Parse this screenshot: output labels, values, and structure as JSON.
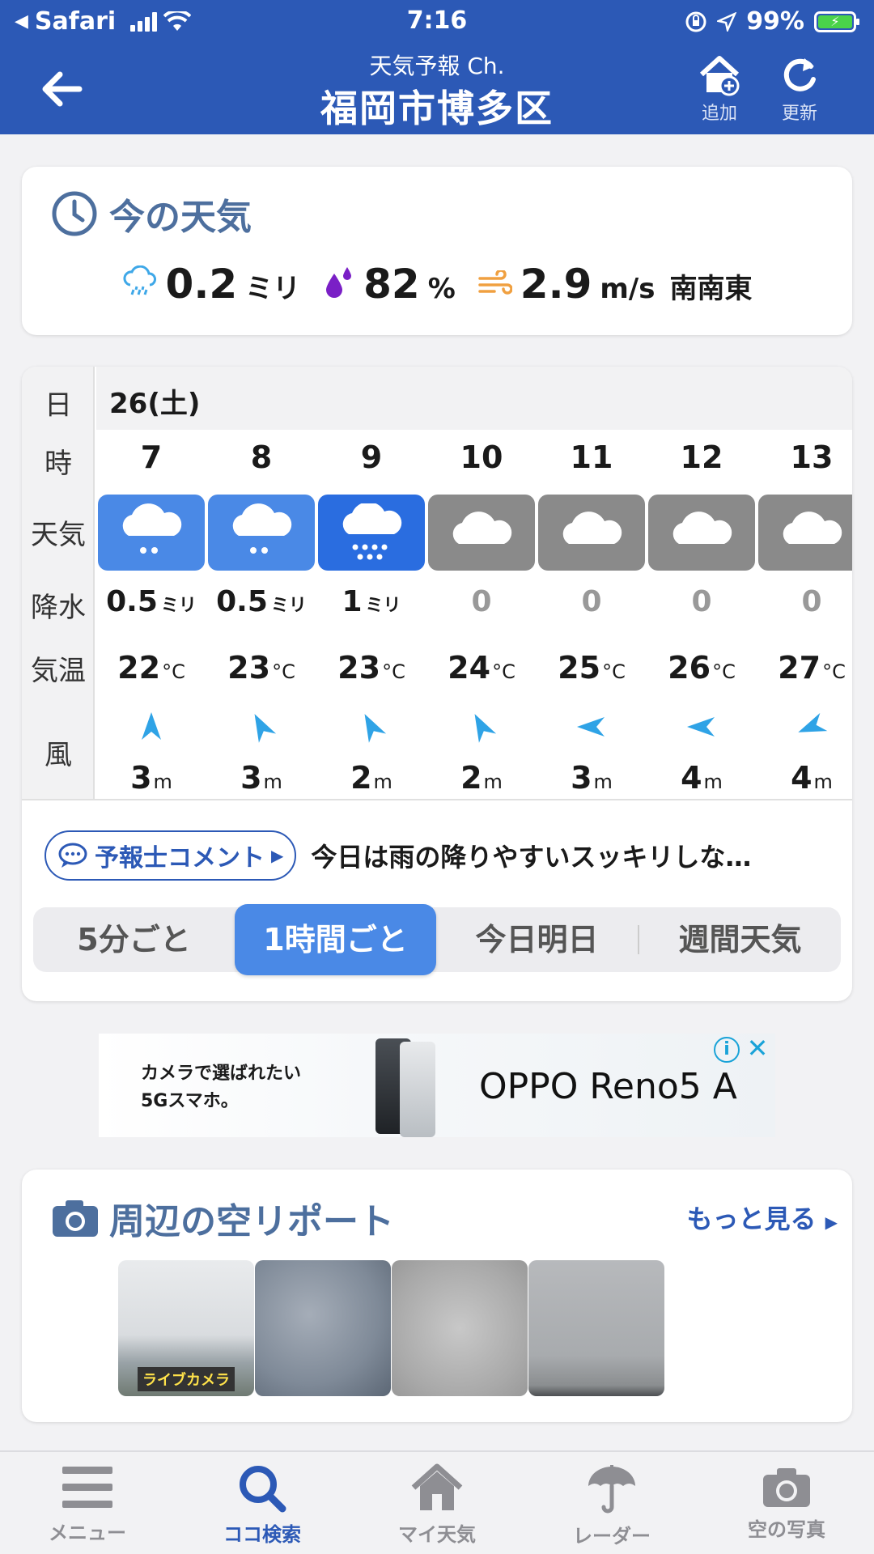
{
  "statusbar": {
    "back_app": "Safari",
    "time": "7:16",
    "battery": "99%"
  },
  "header": {
    "subtitle": "天気予報 Ch.",
    "title": "福岡市博多区",
    "add_label": "追加",
    "refresh_label": "更新"
  },
  "now": {
    "title": "今の天気",
    "precip_value": "0.2",
    "precip_unit": "ミリ",
    "humidity_value": "82",
    "humidity_unit": "%",
    "wind_value": "2.9",
    "wind_unit": "m/s",
    "wind_dir": "南南東"
  },
  "forecast": {
    "labels": {
      "day": "日",
      "hour": "時",
      "weather": "天気",
      "precip": "降水",
      "temp": "気温",
      "wind": "風"
    },
    "day": "26(土)",
    "hours": [
      {
        "hour": "7",
        "weather": "light-rain",
        "precip": "0.5",
        "precip_unit": "ミリ",
        "temp": "22",
        "temp_unit": "°C",
        "wind_dir": "south",
        "wind": "3",
        "wind_unit": "m"
      },
      {
        "hour": "8",
        "weather": "light-rain",
        "precip": "0.5",
        "precip_unit": "ミリ",
        "temp": "23",
        "temp_unit": "°C",
        "wind_dir": "south-southeast",
        "wind": "3",
        "wind_unit": "m"
      },
      {
        "hour": "9",
        "weather": "rain",
        "precip": "1",
        "precip_unit": "ミリ",
        "temp": "23",
        "temp_unit": "°C",
        "wind_dir": "south-southeast",
        "wind": "2",
        "wind_unit": "m"
      },
      {
        "hour": "10",
        "weather": "cloudy",
        "precip": "0",
        "precip_unit": "",
        "temp": "24",
        "temp_unit": "°C",
        "wind_dir": "south-southeast",
        "wind": "2",
        "wind_unit": "m"
      },
      {
        "hour": "11",
        "weather": "cloudy",
        "precip": "0",
        "precip_unit": "",
        "temp": "25",
        "temp_unit": "°C",
        "wind_dir": "east",
        "wind": "3",
        "wind_unit": "m"
      },
      {
        "hour": "12",
        "weather": "cloudy",
        "precip": "0",
        "precip_unit": "",
        "temp": "26",
        "temp_unit": "°C",
        "wind_dir": "east",
        "wind": "4",
        "wind_unit": "m"
      },
      {
        "hour": "13",
        "weather": "cloudy",
        "precip": "0",
        "precip_unit": "",
        "temp": "27",
        "temp_unit": "°C",
        "wind_dir": "east-northeast",
        "wind": "4",
        "wind_unit": "m"
      }
    ],
    "comment_button": "予報士コメント",
    "comment_text": "今日は雨の降りやすいスッキリしな…",
    "tabs": [
      "5分ごと",
      "1時間ごと",
      "今日明日",
      "週間天気"
    ],
    "active_tab": "1時間ごと"
  },
  "ad": {
    "copy_line1": "カメラで選ばれたい",
    "copy_line2": "5Gスマホ。",
    "brand": "OPPO Reno5 A"
  },
  "sky": {
    "title": "周辺の空リポート",
    "more": "もっと見る",
    "live_badge": "ライブカメラ"
  },
  "nav": {
    "items": [
      "メニュー",
      "ココ検索",
      "マイ天気",
      "レーダー",
      "空の写真"
    ],
    "active": "ココ検索"
  },
  "colors": {
    "header": "#2c59b6",
    "light_rain_bg": "#4a89e6",
    "rain_bg": "#2a6de0",
    "cloudy_bg": "#8a8a8a",
    "wind_arrow": "#2fa3e6"
  }
}
